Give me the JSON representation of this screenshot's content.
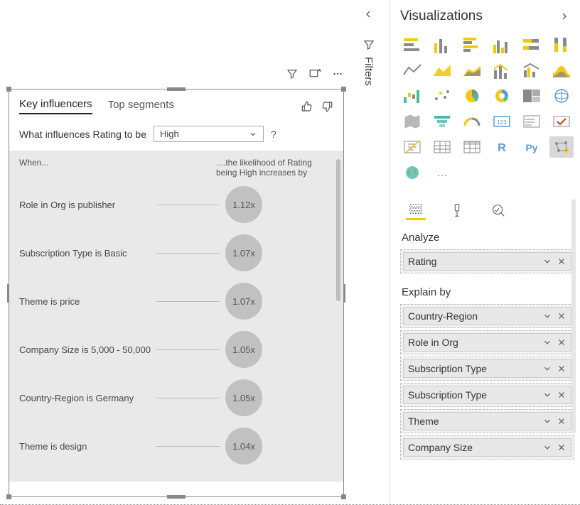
{
  "visual": {
    "tabs": {
      "influencers": "Key influencers",
      "segments": "Top segments"
    },
    "question_prefix": "What influences Rating to be",
    "dropdown_value": "High",
    "when_label": "When...",
    "likelihood_label": "....the likelihood of Rating being High increases by",
    "rows": [
      {
        "label": "Role in Org is publisher",
        "value": "1.12x"
      },
      {
        "label": "Subscription Type is Basic",
        "value": "1.07x"
      },
      {
        "label": "Theme is price",
        "value": "1.07x"
      },
      {
        "label": "Company Size is 5,000 - 50,000",
        "value": "1.05x"
      },
      {
        "label": "Country-Region is Germany",
        "value": "1.05x"
      },
      {
        "label": "Theme is design",
        "value": "1.04x"
      }
    ]
  },
  "filters": {
    "label": "Filters"
  },
  "pane": {
    "title": "Visualizations",
    "analyze_label": "Analyze",
    "explain_label": "Explain by",
    "analyze_fields": [
      "Rating"
    ],
    "explain_fields": [
      "Country-Region",
      "Role in Org",
      "Subscription Type",
      "Subscription Type",
      "Theme",
      "Company Size"
    ]
  },
  "icons": {
    "r_glyph": "R",
    "py_glyph": "Py",
    "dots": "…"
  }
}
